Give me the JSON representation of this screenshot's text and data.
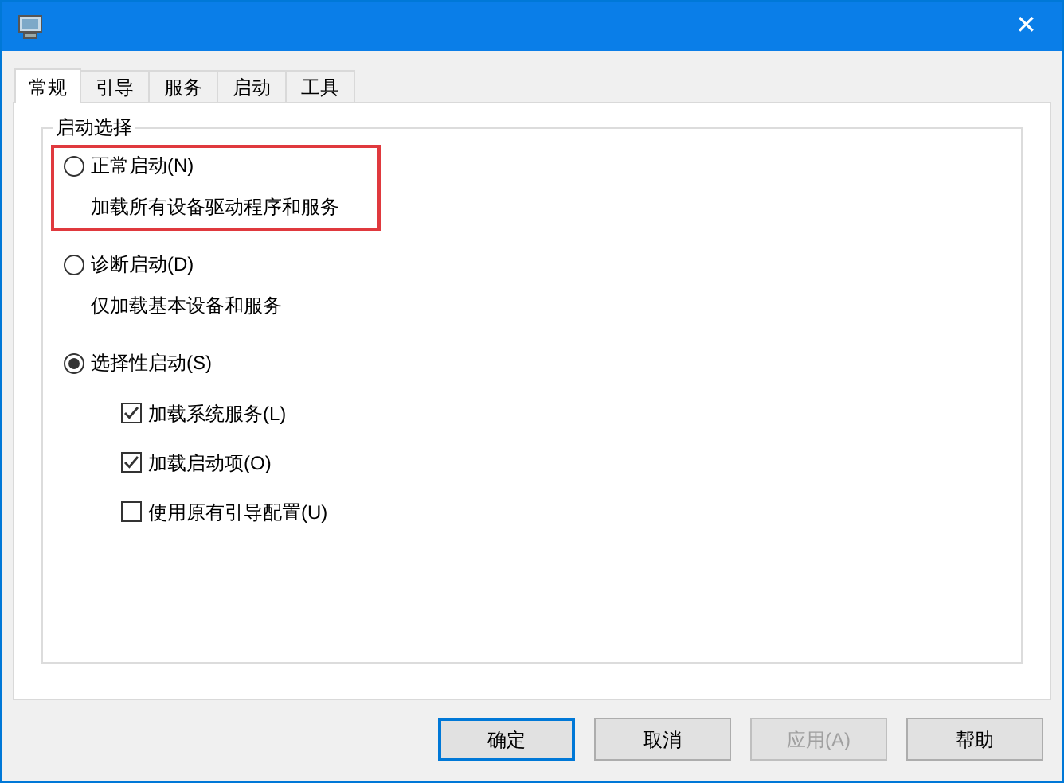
{
  "window": {
    "close": "✕"
  },
  "tabs": [
    {
      "label": "常规",
      "selected": true
    },
    {
      "label": "引导",
      "selected": false
    },
    {
      "label": "服务",
      "selected": false
    },
    {
      "label": "启动",
      "selected": false
    },
    {
      "label": "工具",
      "selected": false
    }
  ],
  "group": {
    "title": "启动选择",
    "options": [
      {
        "label": "正常启动(N)",
        "description": "加载所有设备驱动程序和服务",
        "selected": false,
        "highlighted": true
      },
      {
        "label": "诊断启动(D)",
        "description": "仅加载基本设备和服务",
        "selected": false,
        "highlighted": false
      },
      {
        "label": "选择性启动(S)",
        "selected": true,
        "highlighted": false,
        "checkboxes": [
          {
            "label": "加载系统服务(L)",
            "checked": true
          },
          {
            "label": "加载启动项(O)",
            "checked": true
          },
          {
            "label": "使用原有引导配置(U)",
            "checked": false
          }
        ]
      }
    ]
  },
  "buttons": [
    {
      "label": "确定",
      "default": true,
      "disabled": false
    },
    {
      "label": "取消",
      "default": false,
      "disabled": false
    },
    {
      "label": "应用(A)",
      "default": false,
      "disabled": true
    },
    {
      "label": "帮助",
      "default": false,
      "disabled": false
    }
  ]
}
